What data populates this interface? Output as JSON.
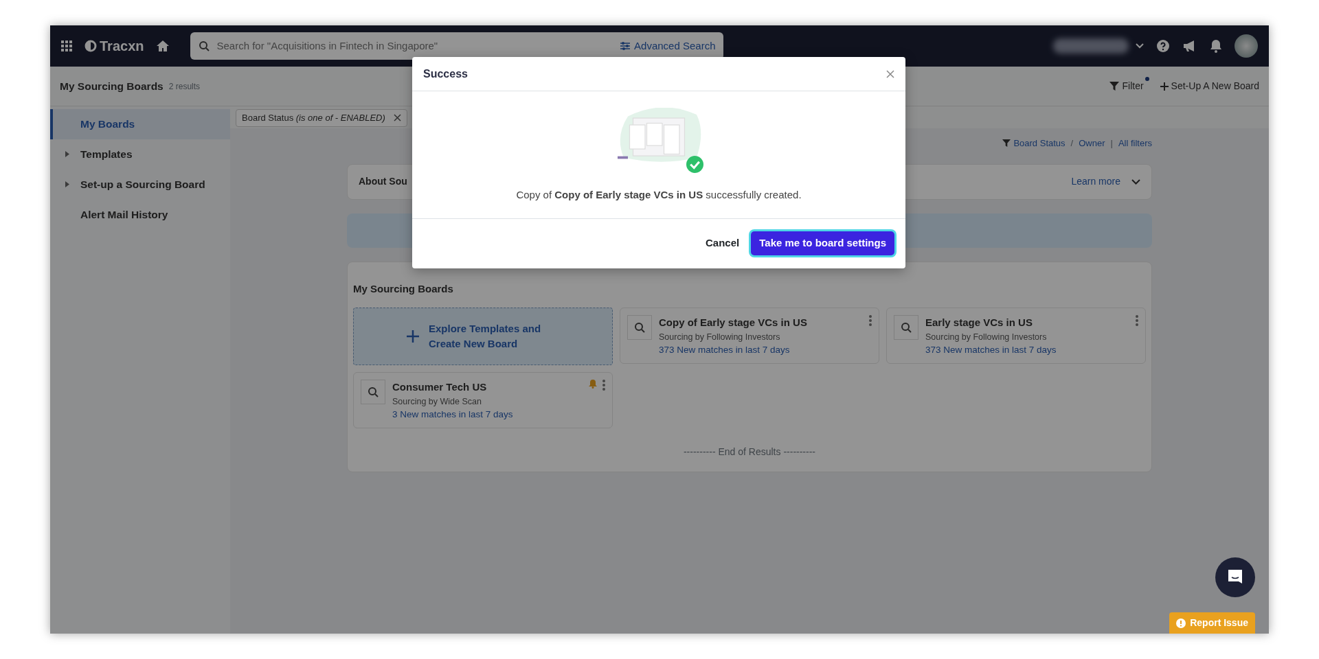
{
  "topbar": {
    "logo": "Tracxn",
    "search": {
      "placeholder": "Search for \"Acquisitions in Fintech in Singapore\""
    },
    "advanced_search": "Advanced Search"
  },
  "header": {
    "title": "My Sourcing Boards",
    "count": "2 results",
    "filter": "Filter",
    "filter_active": true,
    "new_board": "Set-Up A New Board"
  },
  "sidebar": {
    "items": [
      {
        "label": "My Boards",
        "selected": true,
        "expandable": false
      },
      {
        "label": "Templates",
        "selected": false,
        "expandable": true
      },
      {
        "label": "Set-up a Sourcing Board",
        "selected": false,
        "expandable": true
      },
      {
        "label": "Alert Mail History",
        "selected": false,
        "expandable": false
      }
    ]
  },
  "filter_chip": "Board Status *(is one of - ENABLED)*",
  "filter_links": [
    {
      "label": "Board Status",
      "separator": "/"
    },
    {
      "label": "Owner",
      "separator": "|"
    },
    {
      "label": "All filters"
    }
  ],
  "about": {
    "title": "About Sou",
    "link": "Learn more"
  },
  "boards": {
    "title": "My Sourcing Boards",
    "create": "Explore Templates and Create New Board",
    "items": [
      {
        "name": "Copy of Early stage VCs in US",
        "type": "Sourcing by Following Investors",
        "matches": "373 New matches in last 7 days",
        "alert": false
      },
      {
        "name": "Early stage VCs in US",
        "type": "Sourcing by Following Investors",
        "matches": "373 New matches in last 7 days",
        "alert": false
      },
      {
        "name": "Consumer Tech US",
        "type": "Sourcing by Wide Scan",
        "matches": "3 New matches in last 7 days",
        "alert": true
      }
    ],
    "end": "---------- End of Results ----------"
  },
  "modal": {
    "title": "Success",
    "message": "Copy of **Copy of Early stage VCs in US** successfully created.",
    "cancel": "Cancel",
    "confirm": "Take me to board settings"
  },
  "report": "Report Issue"
}
